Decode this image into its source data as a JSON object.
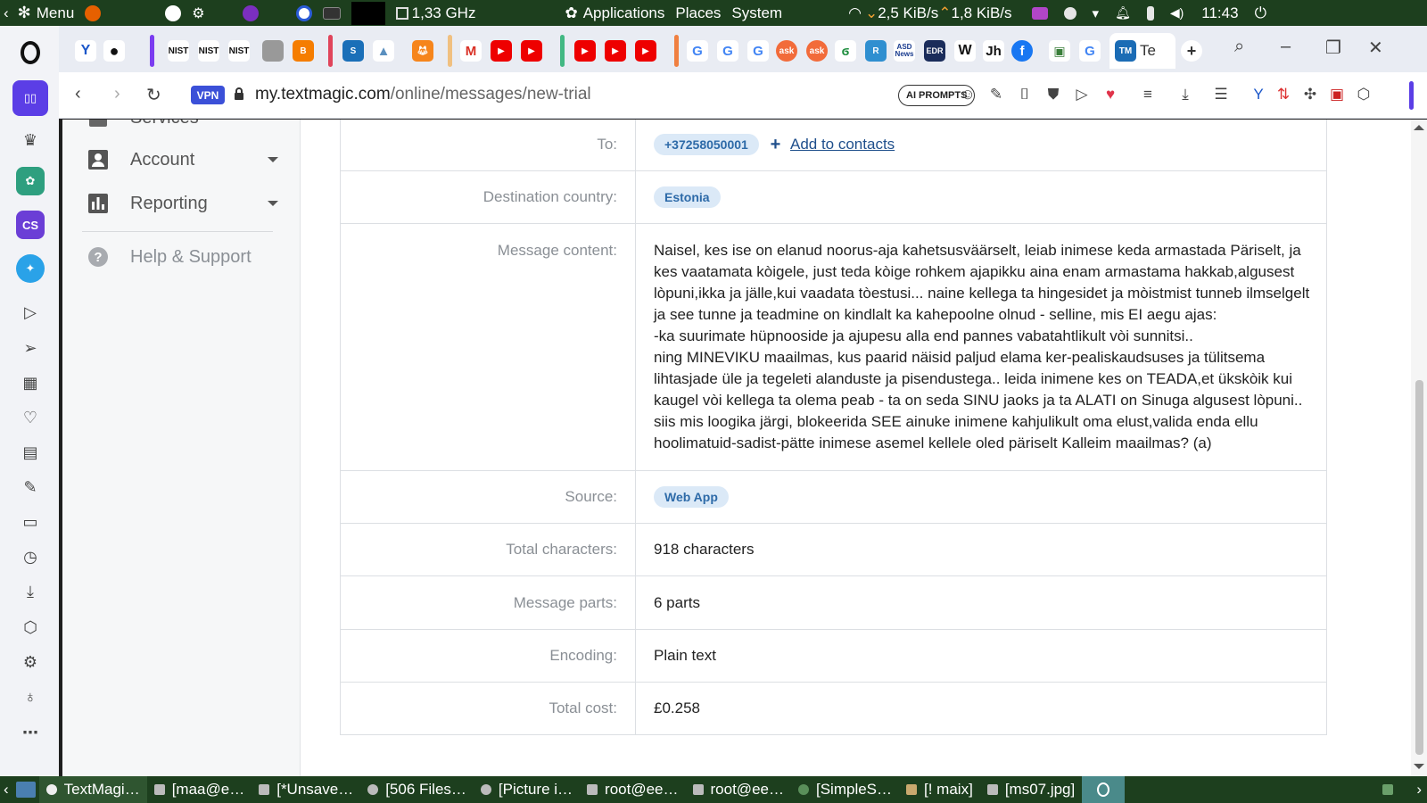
{
  "system_top": {
    "menu_label": "Menu",
    "cpu_freq": "1,33 GHz",
    "menus": [
      "Applications",
      "Places",
      "System"
    ],
    "net_down": "2,5 KiB/s",
    "net_up": "1,8 KiB/s",
    "clock": "11:43"
  },
  "browser": {
    "active_tab_label": "Te",
    "favicons": [
      "NIST",
      "NIST",
      "NIST",
      "G",
      "G",
      "G",
      "ask",
      "ask",
      "W",
      "ASD News",
      "EDR",
      "TM"
    ],
    "url_host": "my.textmagic.com",
    "url_path": "/online/messages/new-trial",
    "vpn_label": "VPN",
    "ai_prompts_label": "AI PROMPTS"
  },
  "sidebar": {
    "items": [
      {
        "label": "Services",
        "icon": "briefcase-icon"
      },
      {
        "label": "Account",
        "icon": "account-icon"
      },
      {
        "label": "Reporting",
        "icon": "bar-chart-icon"
      },
      {
        "label": "Help & Support",
        "icon": "help-icon"
      }
    ]
  },
  "details": {
    "to": {
      "label": "To:",
      "number": "+37258050001",
      "add_contacts": "Add to contacts"
    },
    "destination": {
      "label": "Destination country:",
      "value": "Estonia"
    },
    "message": {
      "label": "Message content:",
      "value": "Naisel, kes ise on elanud noorus-aja kahetsusväärselt, leiab inimese keda armastada Päriselt, ja kes vaatamata kòigele, just teda kòige rohkem ajapikku aina enam armastama hakkab,algusest lòpuni,ikka ja jälle,kui vaadata tòestusi... naine kellega ta hingesidet ja mòistmist tunneb ilmselgelt ja see tunne ja teadmine on kindlalt ka kahepoolne olnud - selline, mis EI aegu ajas:\n-ka suurimate hüpnooside ja ajupesu alla end pannes vabatahtlikult vòi sunnitsi..\nning MINEVIKU maailmas, kus paarid näisid paljud elama ker-pealiskaudsuses ja tülitsema lihtasjade üle ja tegeleti alanduste ja pisendustega.. leida inimene kes on TEADA,et ükskòik kui kaugel vòi kellega ta olema peab - ta on seda SINU jaoks ja ta ALATI on Sinuga algusest lòpuni..\nsiis mis loogika järgi, blokeerida SEE ainuke inimene kahjulikult oma elust,valida enda ellu hoolimatuid-sadist-pätte inimese asemel kellele oled päriselt Kalleim maailmas? (a)"
    },
    "source": {
      "label": "Source:",
      "value": "Web App"
    },
    "total_characters": {
      "label": "Total characters:",
      "value": "918 characters"
    },
    "message_parts": {
      "label": "Message parts:",
      "value": "6 parts"
    },
    "encoding": {
      "label": "Encoding:",
      "value": "Plain text"
    },
    "total_cost": {
      "label": "Total cost:",
      "value": "£0.258"
    }
  },
  "taskbar": {
    "tasks": [
      "TextMagi…",
      "[maa@e…",
      "[*Unsave…",
      "[506 Files…",
      "[Picture i…",
      "root@ee…",
      "root@ee…",
      "[SimpleS…",
      "[! maix]",
      "[ms07.jpg]"
    ]
  },
  "colors": {
    "panel": "#1d3f1e",
    "pill_bg": "#dbe9f7",
    "pill_text": "#2d6aa8",
    "link": "#1f4f8c",
    "vpn": "#3b50d8"
  }
}
